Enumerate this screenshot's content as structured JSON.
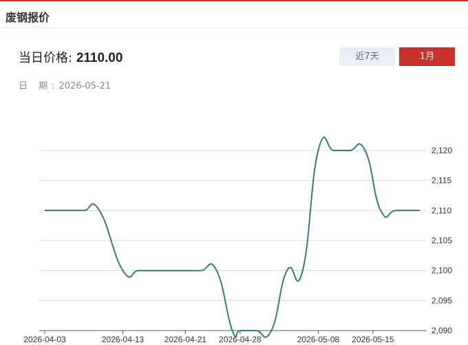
{
  "header": {
    "title": "废钢报价"
  },
  "price": {
    "label": "当日价格:",
    "value": "2110.00"
  },
  "date": {
    "label": "日 期:",
    "value": "2026-05-21"
  },
  "range_buttons": [
    {
      "label": "近7天",
      "active": false
    },
    {
      "label": "1月",
      "active": true
    }
  ],
  "colors": {
    "accent": "#c8322b",
    "line": "#2e7d82",
    "grid": "#d9d9d9",
    "inactive_button": "#e9eef5"
  },
  "chart_data": {
    "type": "line",
    "x": [
      "2026-04-03",
      "2026-04-06",
      "2026-04-08",
      "2026-04-10",
      "2026-04-13",
      "2026-04-15",
      "2026-04-17",
      "2026-04-20",
      "2026-04-21",
      "2026-04-23",
      "2026-04-25",
      "2026-04-27",
      "2026-04-28",
      "2026-04-30",
      "2026-05-02",
      "2026-05-04",
      "2026-05-06",
      "2026-05-08",
      "2026-05-10",
      "2026-05-12",
      "2026-05-14",
      "2026-05-16",
      "2026-05-18",
      "2026-05-21"
    ],
    "series": [
      {
        "values": [
          2110,
          2110,
          2110,
          2110,
          2100,
          2100,
          2100,
          2100,
          2100,
          2100,
          2100,
          2090,
          2090,
          2090,
          2090,
          2100,
          2100,
          2120,
          2120,
          2120,
          2120,
          2110,
          2110,
          2110
        ]
      }
    ],
    "x_ticks": [
      "2026-04-03",
      "2026-04-13",
      "2026-04-21",
      "2026-04-28",
      "2026-05-08",
      "2026-05-15"
    ],
    "y_ticks": [
      "2,090",
      "2,095",
      "2,100",
      "2,105",
      "2,110",
      "2,115",
      "2,120"
    ],
    "ylim": [
      2090,
      2120
    ],
    "y_axis_side": "right",
    "grid": true,
    "legend": "none"
  }
}
